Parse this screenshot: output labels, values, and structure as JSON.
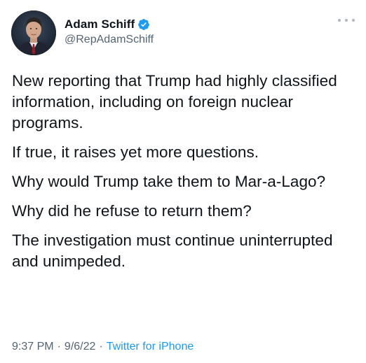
{
  "author": {
    "display_name": "Adam Schiff",
    "handle": "@RepAdamSchiff",
    "verified": true,
    "avatar_icon": "profile-photo"
  },
  "tweet": {
    "paragraphs": [
      "New reporting that Trump had highly classified information, including on foreign nuclear programs.",
      "If true, it raises yet more questions.",
      "Why would Trump take them to Mar-a-Lago?",
      "Why did he refuse to return them?",
      "The investigation must continue uninterrupted and unimpeded."
    ]
  },
  "meta": {
    "time": "9:37 PM",
    "date": "9/6/22",
    "separator": "·",
    "source": "Twitter for iPhone"
  },
  "colors": {
    "text_primary": "#0f1419",
    "text_secondary": "#536471",
    "link": "#1d9bf0",
    "verified": "#1d9bf0"
  },
  "icons": {
    "more": "more-horizontal-icon",
    "verified": "verified-badge-icon"
  }
}
